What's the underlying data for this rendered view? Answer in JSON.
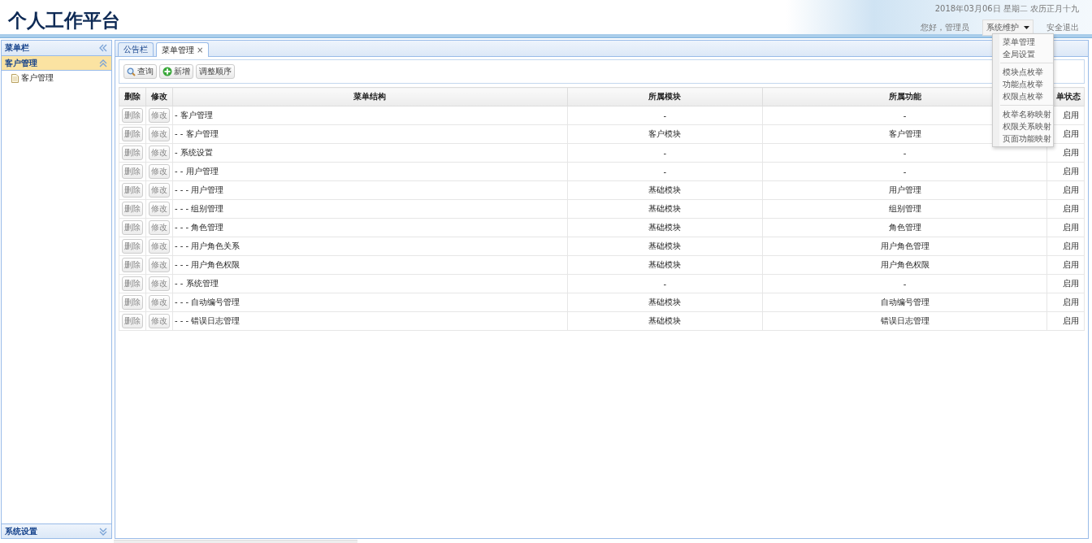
{
  "header": {
    "title": "个人工作平台",
    "date": "2018年03月06日 星期二 农历正月十九",
    "greeting": "您好，管理员",
    "menu_button": "系统维护",
    "logout": "安全退出"
  },
  "dropdown": {
    "open": true,
    "groups": [
      [
        "菜单管理",
        "全局设置"
      ],
      [
        "模块点枚举",
        "功能点枚举",
        "权限点枚举"
      ],
      [
        "枚举名称映射",
        "权限关系映射",
        "页面功能映射"
      ]
    ]
  },
  "sidebar": {
    "title": "菜单栏",
    "sections": [
      {
        "label": "客户管理",
        "expanded": true,
        "items": [
          "客户管理"
        ]
      },
      {
        "label": "系统设置",
        "expanded": false
      }
    ]
  },
  "tabs": [
    {
      "label": "公告栏",
      "selected": false
    },
    {
      "label": "菜单管理",
      "selected": true,
      "close": "×"
    }
  ],
  "toolbar": [
    {
      "label": "查询",
      "kind": "search"
    },
    {
      "label": "新增",
      "kind": "add"
    },
    {
      "label": "调整顺序",
      "kind": "plain"
    }
  ],
  "table": {
    "columns": [
      "删除",
      "修改",
      "菜单结构",
      "所属模块",
      "所属功能",
      "单状态"
    ],
    "rows": [
      {
        "delete": "删除",
        "edit": "修改",
        "structure": "- 客户管理",
        "module": "-",
        "function": "-",
        "status": "启用"
      },
      {
        "delete": "删除",
        "edit": "修改",
        "structure": "- - 客户管理",
        "module": "客户模块",
        "function": "客户管理",
        "status": "启用"
      },
      {
        "delete": "删除",
        "edit": "修改",
        "structure": "- 系统设置",
        "module": "-",
        "function": "-",
        "status": "启用"
      },
      {
        "delete": "删除",
        "edit": "修改",
        "structure": "- - 用户管理",
        "module": "-",
        "function": "-",
        "status": "启用"
      },
      {
        "delete": "删除",
        "edit": "修改",
        "structure": "- - - 用户管理",
        "module": "基础模块",
        "function": "用户管理",
        "status": "启用"
      },
      {
        "delete": "删除",
        "edit": "修改",
        "structure": "- - - 组别管理",
        "module": "基础模块",
        "function": "组别管理",
        "status": "启用"
      },
      {
        "delete": "删除",
        "edit": "修改",
        "structure": "- - - 角色管理",
        "module": "基础模块",
        "function": "角色管理",
        "status": "启用"
      },
      {
        "delete": "删除",
        "edit": "修改",
        "structure": "- - - 用户角色关系",
        "module": "基础模块",
        "function": "用户角色管理",
        "status": "启用"
      },
      {
        "delete": "删除",
        "edit": "修改",
        "structure": "- - - 用户角色权限",
        "module": "基础模块",
        "function": "用户角色权限",
        "status": "启用"
      },
      {
        "delete": "删除",
        "edit": "修改",
        "structure": "- - 系统管理",
        "module": "-",
        "function": "-",
        "status": "启用"
      },
      {
        "delete": "删除",
        "edit": "修改",
        "structure": "- - - 自动编号管理",
        "module": "基础模块",
        "function": "自动编号管理",
        "status": "启用"
      },
      {
        "delete": "删除",
        "edit": "修改",
        "structure": "- - - 错误日志管理",
        "module": "基础模块",
        "function": "错误日志管理",
        "status": "启用"
      }
    ]
  }
}
